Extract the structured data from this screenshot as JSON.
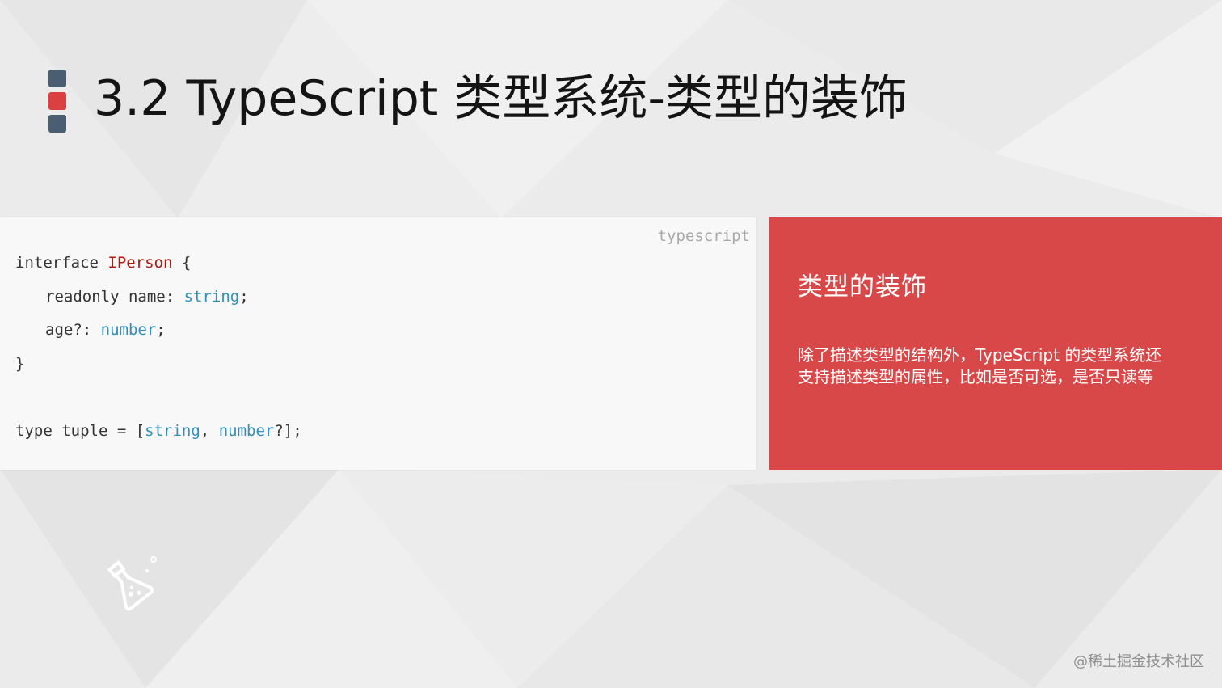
{
  "slide": {
    "title": "3.2 TypeScript 类型系统-类型的装饰",
    "marker_colors": [
      "#4a5d73",
      "#d9403f",
      "#4a5d73"
    ]
  },
  "code_block": {
    "language_label": "typescript",
    "lines": [
      [
        {
          "t": "interface "
        },
        {
          "t": "IPerson",
          "c": "name"
        },
        {
          "t": " {"
        }
      ],
      [
        {
          "t": "readonly name: "
        },
        {
          "t": "string",
          "c": "type"
        },
        {
          "t": ";"
        }
      ],
      [
        {
          "t": "age?: "
        },
        {
          "t": "number",
          "c": "type"
        },
        {
          "t": ";"
        }
      ],
      [
        {
          "t": "}"
        }
      ],
      [],
      [
        {
          "t": "type tuple = ["
        },
        {
          "t": "string",
          "c": "type"
        },
        {
          "t": ", "
        },
        {
          "t": "number",
          "c": "type"
        },
        {
          "t": "?];"
        }
      ]
    ],
    "colors": {
      "type": "#2f8fb9",
      "name": "#b1190d",
      "text": "#333333"
    }
  },
  "info_card": {
    "title": "类型的装饰",
    "body": "除了描述类型的结构外，TypeScript 的类型系统还支持描述类型的属性，比如是否可选，是否只读等",
    "background": "#d84848"
  },
  "logo": {
    "icon": "flask-icon"
  },
  "watermark": "@稀土掘金技术社区"
}
